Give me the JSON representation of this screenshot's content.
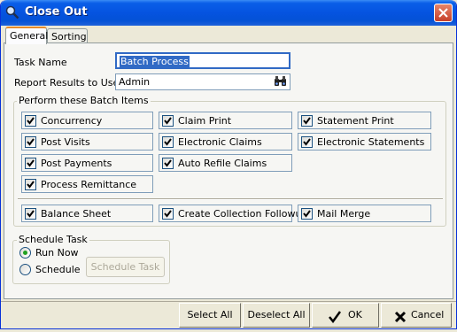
{
  "window": {
    "title": "Close Out"
  },
  "tabs": [
    {
      "label": "General",
      "active": true
    },
    {
      "label": "Sorting",
      "active": false
    }
  ],
  "form": {
    "task_name_label": "Task Name",
    "task_name_value": "Batch Process",
    "report_label": "Report Results to User",
    "report_value": "Admin"
  },
  "batch_group": {
    "legend": "Perform these Batch Items",
    "items": [
      {
        "label": "Concurrency",
        "checked": true
      },
      {
        "label": "Claim Print",
        "checked": true
      },
      {
        "label": "Statement Print",
        "checked": true
      },
      {
        "label": "Post Visits",
        "checked": true
      },
      {
        "label": "Electronic Claims",
        "checked": true
      },
      {
        "label": "Electronic Statements",
        "checked": true
      },
      {
        "label": "Post Payments",
        "checked": true
      },
      {
        "label": "Auto Refile Claims",
        "checked": true
      },
      {
        "label": "Process Remittance",
        "checked": true
      },
      {
        "label": "Balance Sheet",
        "checked": true
      },
      {
        "label": "Create Collection Followup",
        "checked": true
      },
      {
        "label": "Mail Merge",
        "checked": true
      }
    ]
  },
  "schedule_group": {
    "legend": "Schedule Task",
    "run_now_label": "Run Now",
    "schedule_label": "Schedule",
    "schedule_task_button": "Schedule Task",
    "selected": "Run Now"
  },
  "buttons": {
    "select_all": "Select All",
    "deselect_all": "Deselect All",
    "ok": "OK",
    "cancel": "Cancel"
  },
  "colors": {
    "titlebar": "#0553e0",
    "selection": "#316ac5",
    "checkmark": "#21a121",
    "cancel_x": "#000000"
  }
}
